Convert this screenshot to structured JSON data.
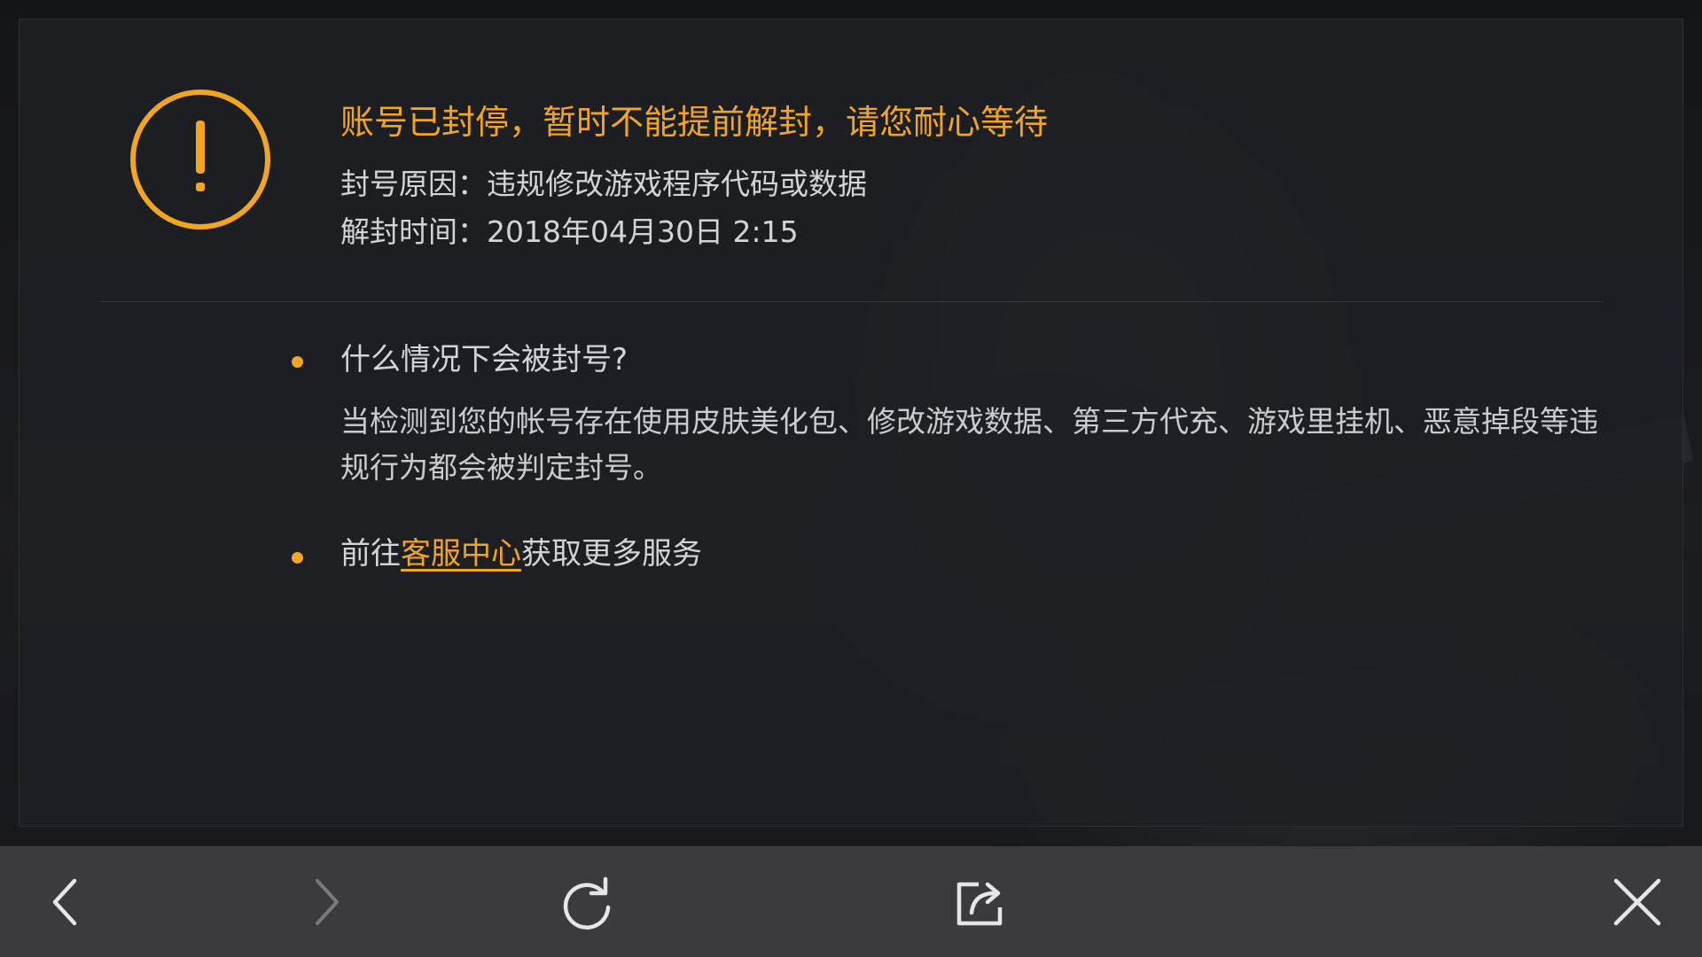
{
  "colors": {
    "accent": "#f1a524",
    "text": "#d2d4d7",
    "toolbar_bg": "#3b3b3d",
    "icon": "#e6e6e6",
    "icon_disabled": "#7a7a7c"
  },
  "ban_notice": {
    "icon": "exclamation-circle-icon",
    "title": "账号已封停，暂时不能提前解封，请您耐心等待",
    "reason": "封号原因：违规修改游戏程序代码或数据",
    "unban_time": "解封时间：2018年04月30日 2:15"
  },
  "faq": {
    "question": "什么情况下会被封号?",
    "answer": "当检测到您的帐号存在使用皮肤美化包、修改游戏数据、第三方代充、游戏里挂机、恶意掉段等违规行为都会被判定封号。"
  },
  "service": {
    "prefix": "前往",
    "link_label": "客服中心",
    "suffix": "获取更多服务"
  },
  "toolbar": {
    "buttons": [
      {
        "name": "back",
        "icon": "chevron-left-icon",
        "enabled": true
      },
      {
        "name": "forward",
        "icon": "chevron-right-icon",
        "enabled": false
      },
      {
        "name": "refresh",
        "icon": "refresh-icon",
        "enabled": true
      },
      {
        "name": "share",
        "icon": "share-icon",
        "enabled": true
      },
      {
        "name": "close",
        "icon": "close-icon",
        "enabled": true
      }
    ]
  }
}
